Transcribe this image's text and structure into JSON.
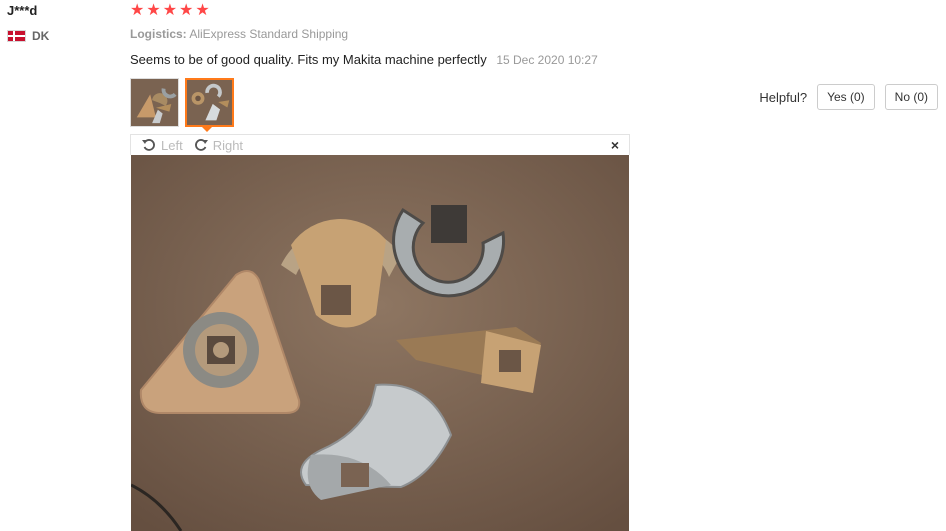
{
  "user": {
    "name": "J***d",
    "country": "DK"
  },
  "rating": {
    "stars": 5
  },
  "logistics": {
    "label": "Logistics:",
    "value": "AliExpress Standard Shipping"
  },
  "review": {
    "text": "Seems to be of good quality. Fits my Makita machine perfectly",
    "date": "15 Dec 2020 10:27"
  },
  "helpful": {
    "label": "Helpful?",
    "yes": "Yes (0)",
    "no": "No (0)"
  },
  "viewer": {
    "left": "Left",
    "right": "Right",
    "close": "×"
  },
  "colors": {
    "star": "#ff4747",
    "active_border": "#ff7a1a"
  },
  "icons": {
    "star": "star-icon",
    "rotate_left": "rotate-left-icon",
    "rotate_right": "rotate-right-icon",
    "close": "close-icon"
  }
}
